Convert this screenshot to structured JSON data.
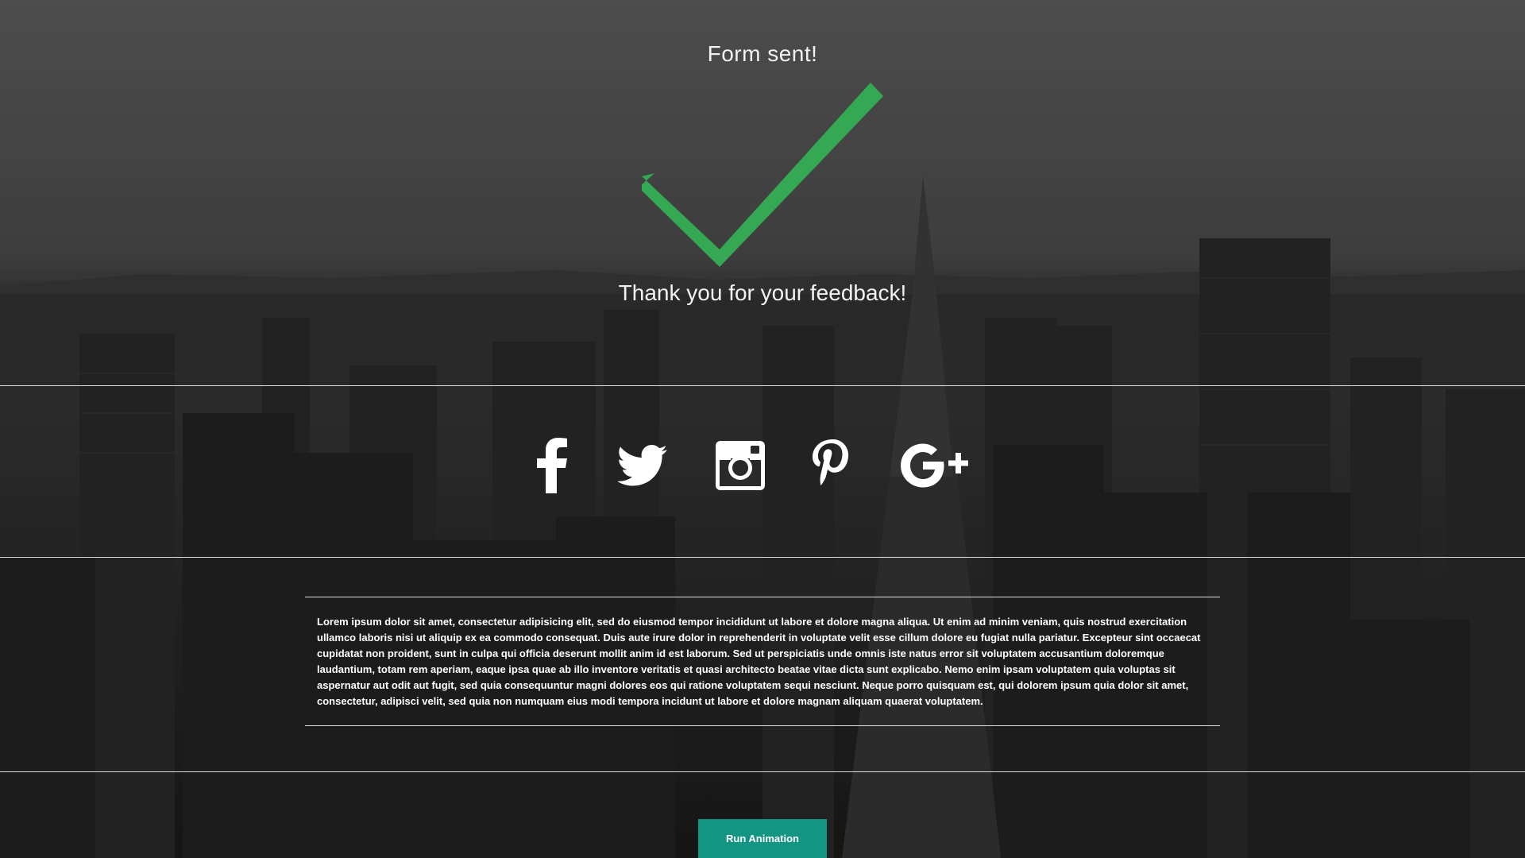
{
  "page": {
    "title": "Form sent!",
    "thanks": "Thank you for your feedback!"
  },
  "status": {
    "icon": "checkmark-icon",
    "color": "#34a853"
  },
  "social": [
    {
      "name": "facebook-icon"
    },
    {
      "name": "twitter-icon"
    },
    {
      "name": "instagram-icon"
    },
    {
      "name": "pinterest-icon"
    },
    {
      "name": "google-plus-icon"
    }
  ],
  "body_text": "Lorem ipsum dolor sit amet, consectetur adipisicing elit, sed do eiusmod tempor incididunt ut labore et dolore magna aliqua. Ut enim ad minim veniam, quis nostrud exercitation ullamco laboris nisi ut aliquip ex ea commodo consequat. Duis aute irure dolor in reprehenderit in voluptate velit esse cillum dolore eu fugiat nulla pariatur. Excepteur sint occaecat cupidatat non proident, sunt in culpa qui officia deserunt mollit anim id est laborum. Sed ut perspiciatis unde omnis iste natus error sit voluptatem accusantium doloremque laudantium, totam rem aperiam, eaque ipsa quae ab illo inventore veritatis et quasi architecto beatae vitae dicta sunt explicabo. Nemo enim ipsam voluptatem quia voluptas sit aspernatur aut odit aut fugit, sed quia consequuntur magni dolores eos qui ratione voluptatem sequi nesciunt. Neque porro quisquam est, qui dolorem ipsum quia dolor sit amet, consectetur, adipisci velit, sed quia non numquam eius modi tempora incidunt ut labore et dolore magnam aliquam quaerat voluptatem.",
  "actions": {
    "run_label": "Run Animation",
    "button_color": "#149482"
  }
}
